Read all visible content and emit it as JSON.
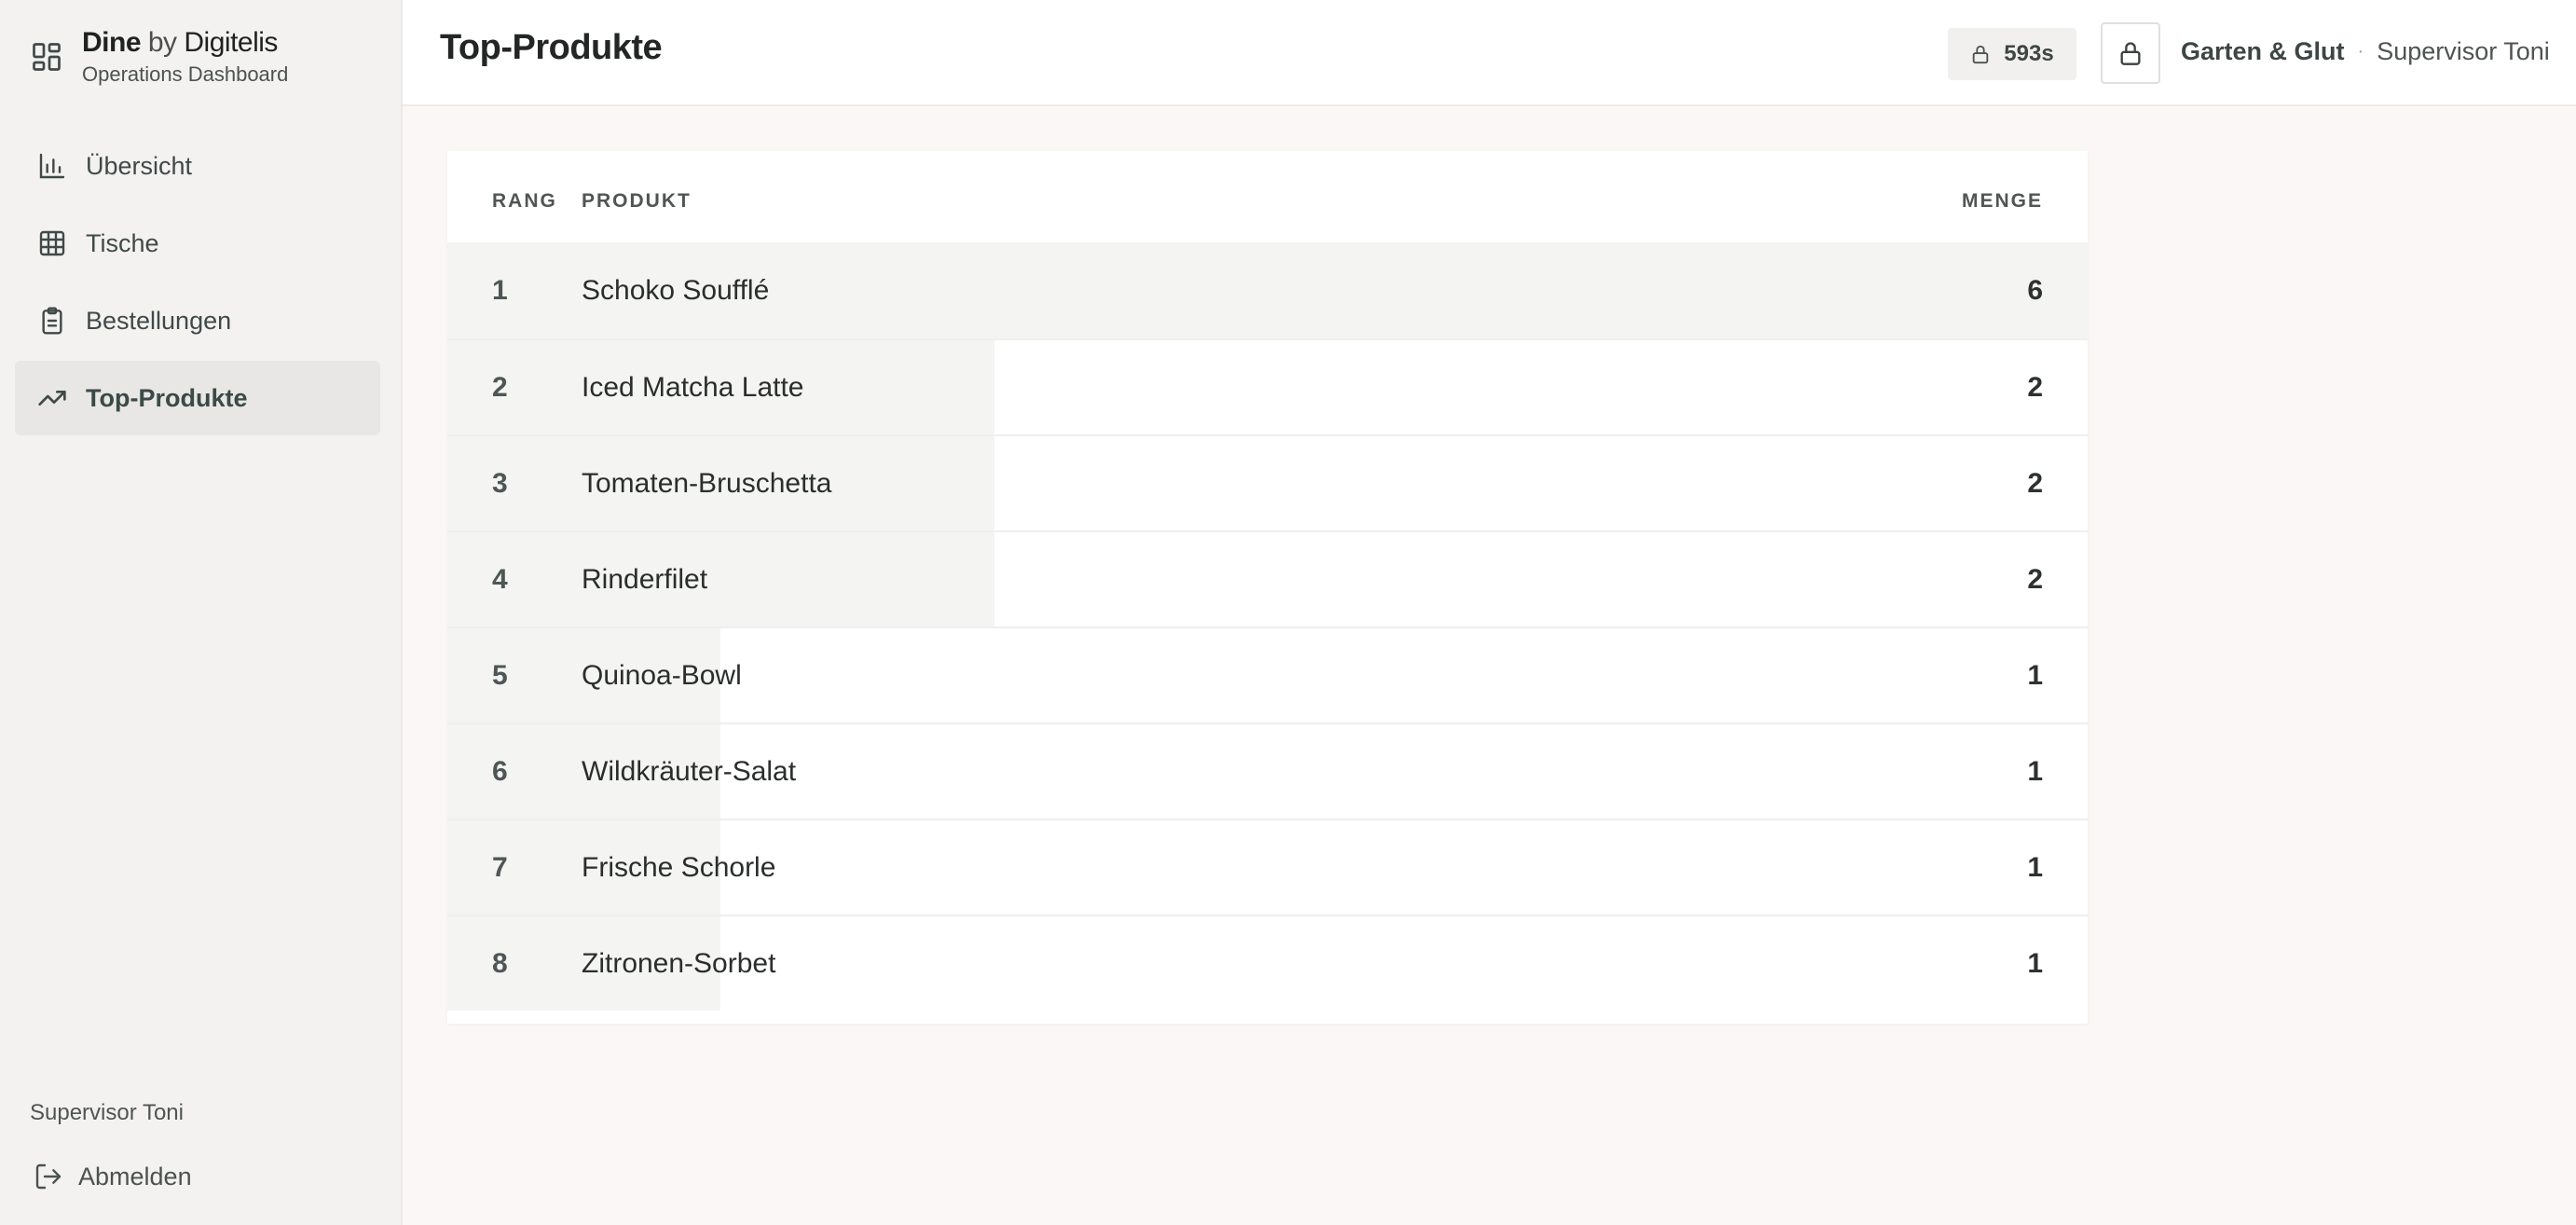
{
  "brand": {
    "name": "Dine",
    "by": "by",
    "company": "Digitelis",
    "subtitle": "Operations Dashboard"
  },
  "nav": {
    "items": [
      {
        "label": "Übersicht",
        "icon": "bar-chart-icon",
        "active": false
      },
      {
        "label": "Tische",
        "icon": "grid-table-icon",
        "active": false
      },
      {
        "label": "Bestellungen",
        "icon": "clipboard-icon",
        "active": false
      },
      {
        "label": "Top-Produkte",
        "icon": "trending-up-icon",
        "active": true
      }
    ]
  },
  "sidebar": {
    "user_name": "Supervisor Toni",
    "logout_label": "Abmelden"
  },
  "header": {
    "title": "Top-Produkte",
    "timer": "593s",
    "restaurant": "Garten & Glut",
    "separator": "·",
    "user": "Supervisor Toni"
  },
  "table": {
    "columns": {
      "rank": "RANG",
      "product": "PRODUKT",
      "quantity": "MENGE"
    },
    "max_quantity": 6,
    "rows": [
      {
        "rank": "1",
        "product": "Schoko Soufflé",
        "quantity": 6
      },
      {
        "rank": "2",
        "product": "Iced Matcha Latte",
        "quantity": 2
      },
      {
        "rank": "3",
        "product": "Tomaten-Bruschetta",
        "quantity": 2
      },
      {
        "rank": "4",
        "product": "Rinderfilet",
        "quantity": 2
      },
      {
        "rank": "5",
        "product": "Quinoa-Bowl",
        "quantity": 1
      },
      {
        "rank": "6",
        "product": "Wildkräuter-Salat",
        "quantity": 1
      },
      {
        "rank": "7",
        "product": "Frische Schorle",
        "quantity": 1
      },
      {
        "rank": "8",
        "product": "Zitronen-Sorbet",
        "quantity": 1
      }
    ]
  }
}
